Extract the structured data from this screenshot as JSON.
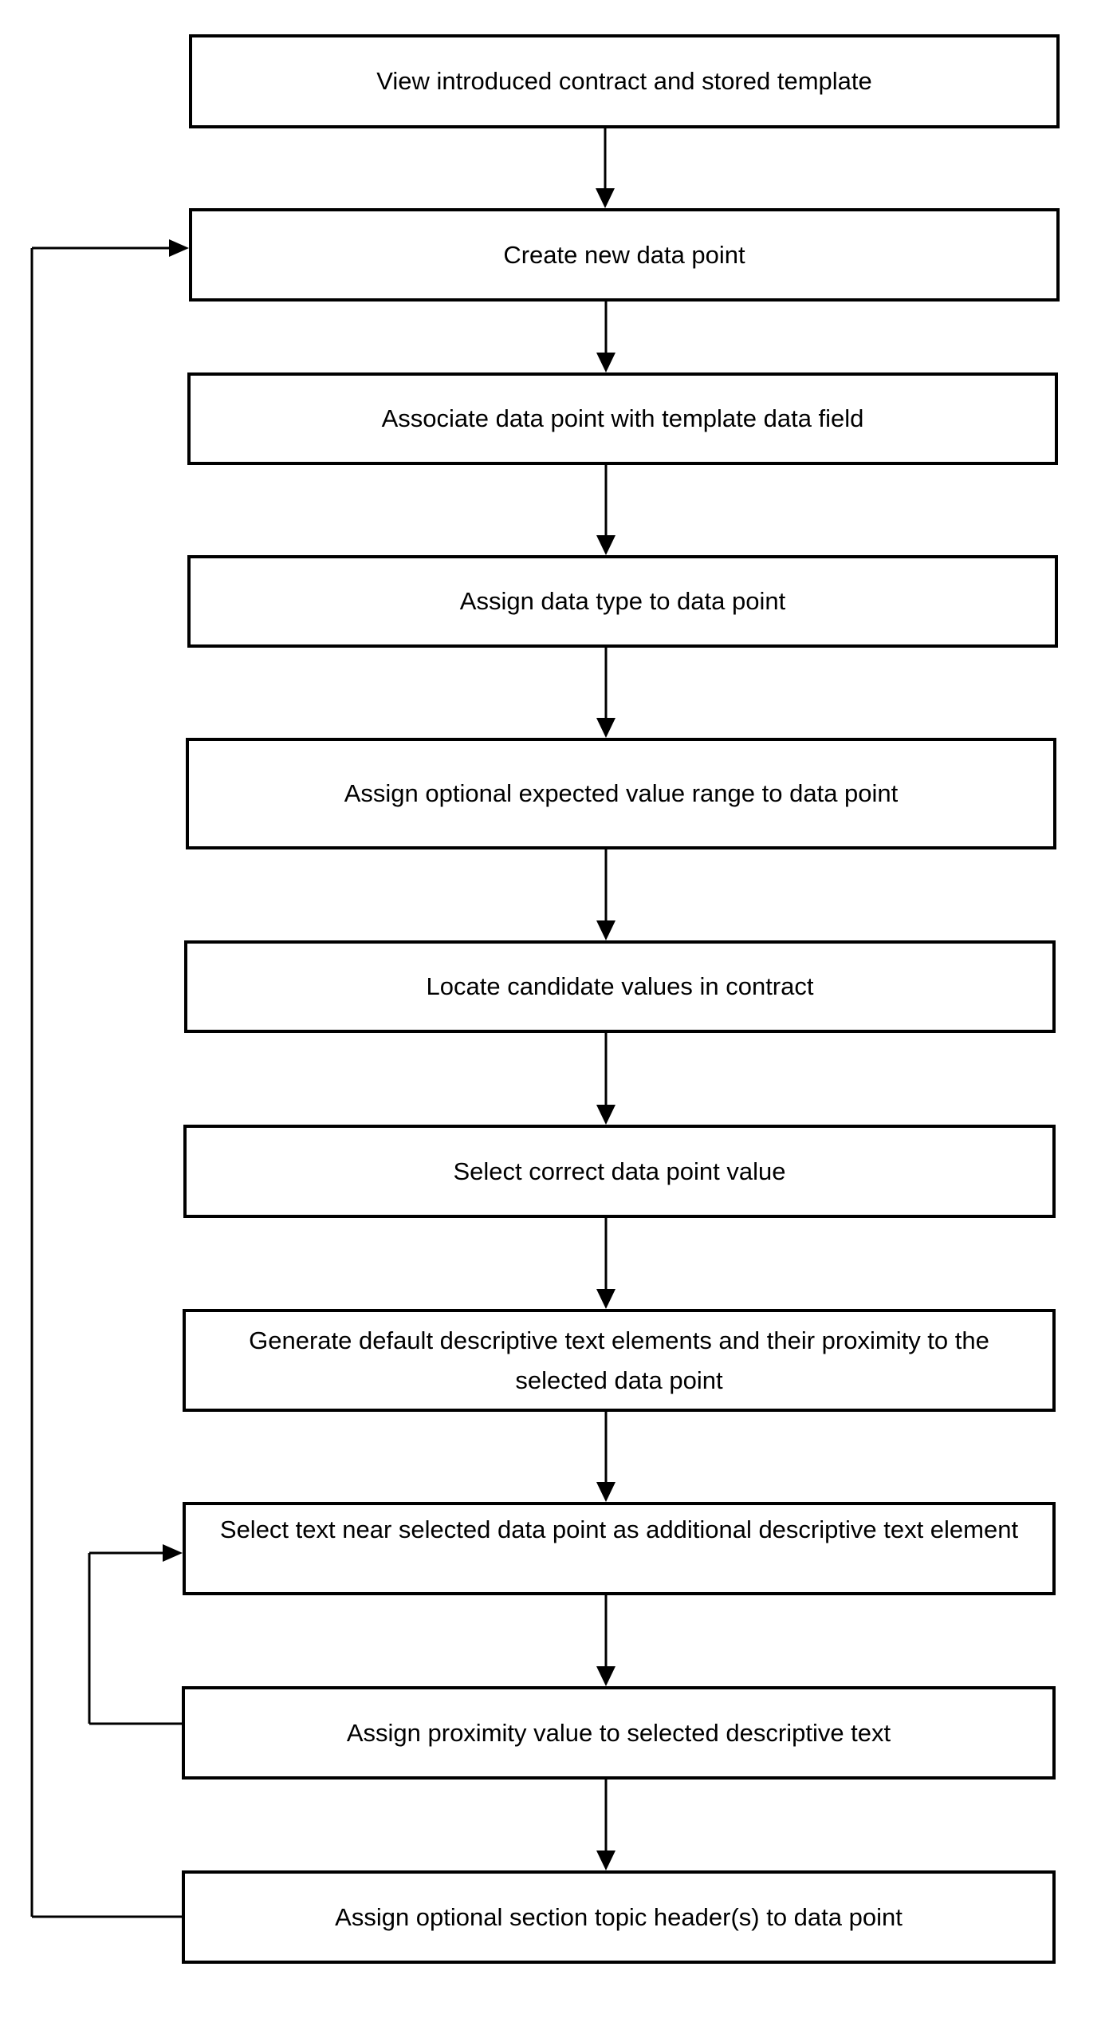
{
  "diagram": {
    "type": "flowchart",
    "colors": {
      "stroke": "#000000",
      "background": "#ffffff",
      "text": "#000000"
    },
    "steps": [
      {
        "id": "s1",
        "label": "View introduced contract and stored template"
      },
      {
        "id": "s2",
        "label": "Create new data point"
      },
      {
        "id": "s3",
        "label": "Associate data point with template data field"
      },
      {
        "id": "s4",
        "label": "Assign data type to data point"
      },
      {
        "id": "s5",
        "label": "Assign optional expected value range to data point"
      },
      {
        "id": "s6",
        "label": "Locate candidate values in contract"
      },
      {
        "id": "s7",
        "label": "Select correct data point value"
      },
      {
        "id": "s8",
        "label": "Generate default descriptive text elements and their proximity to the selected data point"
      },
      {
        "id": "s9",
        "label": "Select text near selected data point as additional descriptive text element"
      },
      {
        "id": "s10",
        "label": "Assign proximity value to selected descriptive text"
      },
      {
        "id": "s11",
        "label": "Assign optional section topic header(s) to data point"
      }
    ],
    "edges": [
      {
        "from": "s1",
        "to": "s2"
      },
      {
        "from": "s2",
        "to": "s3"
      },
      {
        "from": "s3",
        "to": "s4"
      },
      {
        "from": "s4",
        "to": "s5"
      },
      {
        "from": "s5",
        "to": "s6"
      },
      {
        "from": "s6",
        "to": "s7"
      },
      {
        "from": "s7",
        "to": "s8"
      },
      {
        "from": "s8",
        "to": "s9"
      },
      {
        "from": "s9",
        "to": "s10"
      },
      {
        "from": "s10",
        "to": "s11"
      },
      {
        "from": "s10",
        "to": "s9",
        "kind": "loop"
      },
      {
        "from": "s11",
        "to": "s2",
        "kind": "loop"
      }
    ]
  }
}
